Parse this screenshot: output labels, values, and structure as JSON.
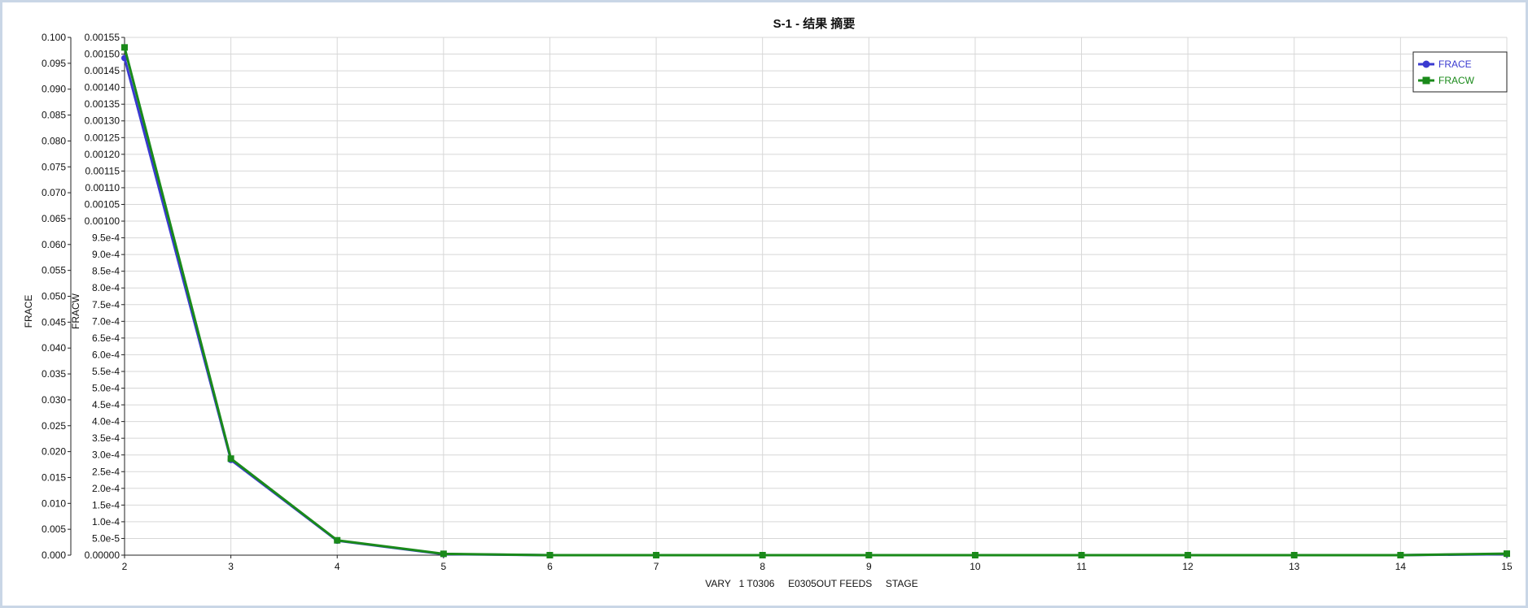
{
  "chart_data": {
    "type": "line",
    "title": "S-1 - 结果 摘要",
    "xlabel": "VARY   1 T0306     E0305OUT FEEDS     STAGE",
    "x": [
      2,
      3,
      4,
      5,
      6,
      7,
      8,
      9,
      10,
      11,
      12,
      13,
      14,
      15
    ],
    "xlim": [
      2,
      15
    ],
    "x_ticks": [
      "2",
      "3",
      "4",
      "5",
      "6",
      "7",
      "8",
      "9",
      "10",
      "11",
      "12",
      "13",
      "14",
      "15"
    ],
    "left_axis": {
      "label": "FRACE",
      "ylim": [
        0,
        0.1
      ],
      "ticks": [
        "0.000",
        "0.005",
        "0.010",
        "0.015",
        "0.020",
        "0.025",
        "0.030",
        "0.035",
        "0.040",
        "0.045",
        "0.050",
        "0.055",
        "0.060",
        "0.065",
        "0.070",
        "0.075",
        "0.080",
        "0.085",
        "0.090",
        "0.095",
        "0.100"
      ]
    },
    "right_axis": {
      "label": "FRACW",
      "ylim": [
        0,
        0.00155
      ],
      "ticks": [
        "0.00000",
        "5.0e-5",
        "1.0e-4",
        "1.5e-4",
        "2.0e-4",
        "2.5e-4",
        "3.0e-4",
        "3.5e-4",
        "4.0e-4",
        "4.5e-4",
        "5.0e-4",
        "5.5e-4",
        "6.0e-4",
        "6.5e-4",
        "7.0e-4",
        "7.5e-4",
        "8.0e-4",
        "8.5e-4",
        "9.0e-4",
        "9.5e-4",
        "0.00100",
        "0.00105",
        "0.00110",
        "0.00115",
        "0.00120",
        "0.00125",
        "0.00130",
        "0.00135",
        "0.00140",
        "0.00145",
        "0.00150",
        "0.00155"
      ]
    },
    "grid": true,
    "legend_position": "top-right",
    "series": [
      {
        "name": "FRACE",
        "axis": "left",
        "color": "#3a3ad0",
        "marker": "circle",
        "values": [
          0.096,
          0.0184,
          0.0028,
          0.0002,
          0.0,
          0.0,
          0.0,
          0.0,
          0.0,
          0.0,
          0.0,
          0.0,
          0.0,
          0.0002
        ]
      },
      {
        "name": "FRACW",
        "axis": "right",
        "color": "#1a8a1a",
        "marker": "square",
        "values": [
          0.00152,
          0.000289,
          4.45e-05,
          4e-06,
          0.0,
          0.0,
          0.0,
          0.0,
          0.0,
          0.0,
          0.0,
          0.0,
          0.0,
          4.5e-06
        ]
      }
    ]
  }
}
